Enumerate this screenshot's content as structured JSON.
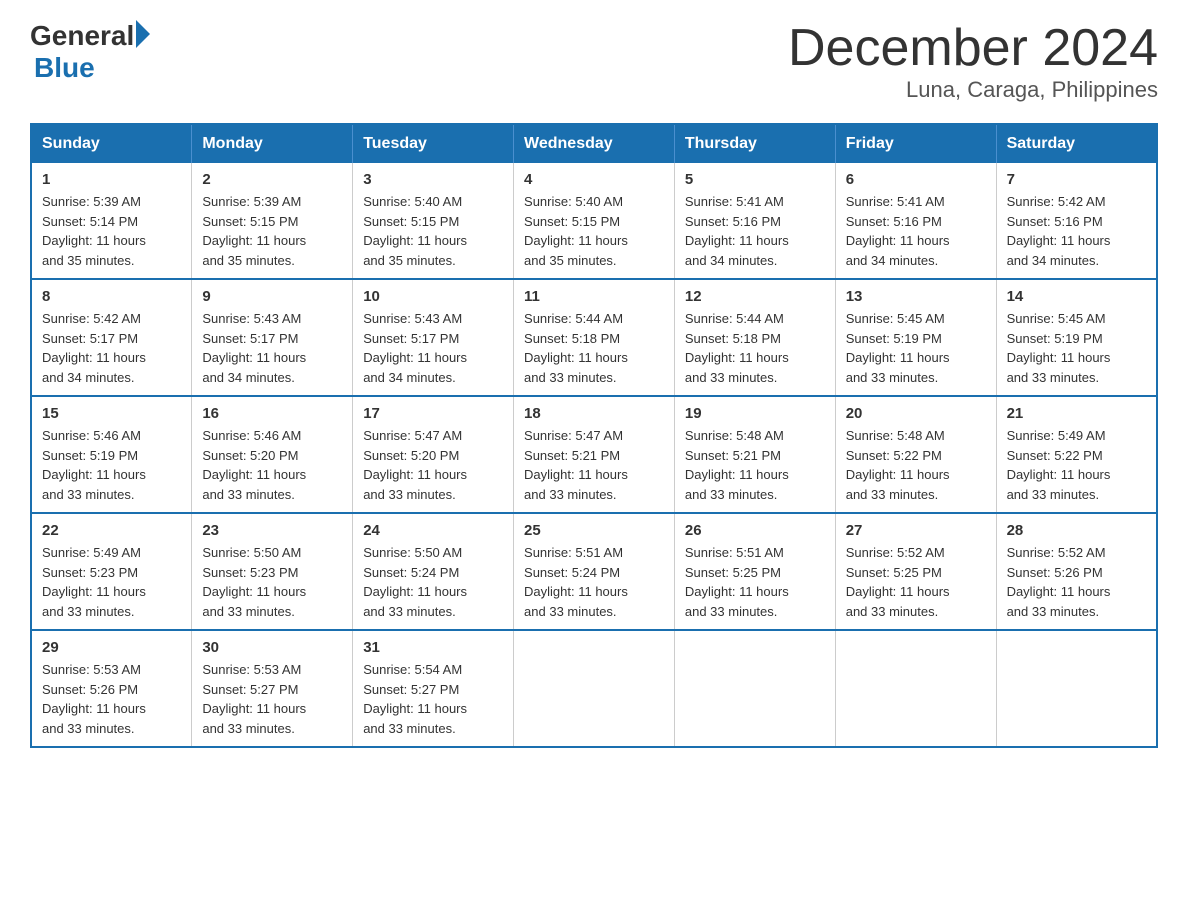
{
  "header": {
    "logo_general": "General",
    "logo_blue": "Blue",
    "month_title": "December 2024",
    "subtitle": "Luna, Caraga, Philippines"
  },
  "weekdays": [
    "Sunday",
    "Monday",
    "Tuesday",
    "Wednesday",
    "Thursday",
    "Friday",
    "Saturday"
  ],
  "weeks": [
    [
      {
        "day": "1",
        "sunrise": "5:39 AM",
        "sunset": "5:14 PM",
        "daylight": "11 hours and 35 minutes."
      },
      {
        "day": "2",
        "sunrise": "5:39 AM",
        "sunset": "5:15 PM",
        "daylight": "11 hours and 35 minutes."
      },
      {
        "day": "3",
        "sunrise": "5:40 AM",
        "sunset": "5:15 PM",
        "daylight": "11 hours and 35 minutes."
      },
      {
        "day": "4",
        "sunrise": "5:40 AM",
        "sunset": "5:15 PM",
        "daylight": "11 hours and 35 minutes."
      },
      {
        "day": "5",
        "sunrise": "5:41 AM",
        "sunset": "5:16 PM",
        "daylight": "11 hours and 34 minutes."
      },
      {
        "day": "6",
        "sunrise": "5:41 AM",
        "sunset": "5:16 PM",
        "daylight": "11 hours and 34 minutes."
      },
      {
        "day": "7",
        "sunrise": "5:42 AM",
        "sunset": "5:16 PM",
        "daylight": "11 hours and 34 minutes."
      }
    ],
    [
      {
        "day": "8",
        "sunrise": "5:42 AM",
        "sunset": "5:17 PM",
        "daylight": "11 hours and 34 minutes."
      },
      {
        "day": "9",
        "sunrise": "5:43 AM",
        "sunset": "5:17 PM",
        "daylight": "11 hours and 34 minutes."
      },
      {
        "day": "10",
        "sunrise": "5:43 AM",
        "sunset": "5:17 PM",
        "daylight": "11 hours and 34 minutes."
      },
      {
        "day": "11",
        "sunrise": "5:44 AM",
        "sunset": "5:18 PM",
        "daylight": "11 hours and 33 minutes."
      },
      {
        "day": "12",
        "sunrise": "5:44 AM",
        "sunset": "5:18 PM",
        "daylight": "11 hours and 33 minutes."
      },
      {
        "day": "13",
        "sunrise": "5:45 AM",
        "sunset": "5:19 PM",
        "daylight": "11 hours and 33 minutes."
      },
      {
        "day": "14",
        "sunrise": "5:45 AM",
        "sunset": "5:19 PM",
        "daylight": "11 hours and 33 minutes."
      }
    ],
    [
      {
        "day": "15",
        "sunrise": "5:46 AM",
        "sunset": "5:19 PM",
        "daylight": "11 hours and 33 minutes."
      },
      {
        "day": "16",
        "sunrise": "5:46 AM",
        "sunset": "5:20 PM",
        "daylight": "11 hours and 33 minutes."
      },
      {
        "day": "17",
        "sunrise": "5:47 AM",
        "sunset": "5:20 PM",
        "daylight": "11 hours and 33 minutes."
      },
      {
        "day": "18",
        "sunrise": "5:47 AM",
        "sunset": "5:21 PM",
        "daylight": "11 hours and 33 minutes."
      },
      {
        "day": "19",
        "sunrise": "5:48 AM",
        "sunset": "5:21 PM",
        "daylight": "11 hours and 33 minutes."
      },
      {
        "day": "20",
        "sunrise": "5:48 AM",
        "sunset": "5:22 PM",
        "daylight": "11 hours and 33 minutes."
      },
      {
        "day": "21",
        "sunrise": "5:49 AM",
        "sunset": "5:22 PM",
        "daylight": "11 hours and 33 minutes."
      }
    ],
    [
      {
        "day": "22",
        "sunrise": "5:49 AM",
        "sunset": "5:23 PM",
        "daylight": "11 hours and 33 minutes."
      },
      {
        "day": "23",
        "sunrise": "5:50 AM",
        "sunset": "5:23 PM",
        "daylight": "11 hours and 33 minutes."
      },
      {
        "day": "24",
        "sunrise": "5:50 AM",
        "sunset": "5:24 PM",
        "daylight": "11 hours and 33 minutes."
      },
      {
        "day": "25",
        "sunrise": "5:51 AM",
        "sunset": "5:24 PM",
        "daylight": "11 hours and 33 minutes."
      },
      {
        "day": "26",
        "sunrise": "5:51 AM",
        "sunset": "5:25 PM",
        "daylight": "11 hours and 33 minutes."
      },
      {
        "day": "27",
        "sunrise": "5:52 AM",
        "sunset": "5:25 PM",
        "daylight": "11 hours and 33 minutes."
      },
      {
        "day": "28",
        "sunrise": "5:52 AM",
        "sunset": "5:26 PM",
        "daylight": "11 hours and 33 minutes."
      }
    ],
    [
      {
        "day": "29",
        "sunrise": "5:53 AM",
        "sunset": "5:26 PM",
        "daylight": "11 hours and 33 minutes."
      },
      {
        "day": "30",
        "sunrise": "5:53 AM",
        "sunset": "5:27 PM",
        "daylight": "11 hours and 33 minutes."
      },
      {
        "day": "31",
        "sunrise": "5:54 AM",
        "sunset": "5:27 PM",
        "daylight": "11 hours and 33 minutes."
      },
      null,
      null,
      null,
      null
    ]
  ],
  "labels": {
    "sunrise": "Sunrise:",
    "sunset": "Sunset:",
    "daylight": "Daylight:"
  }
}
